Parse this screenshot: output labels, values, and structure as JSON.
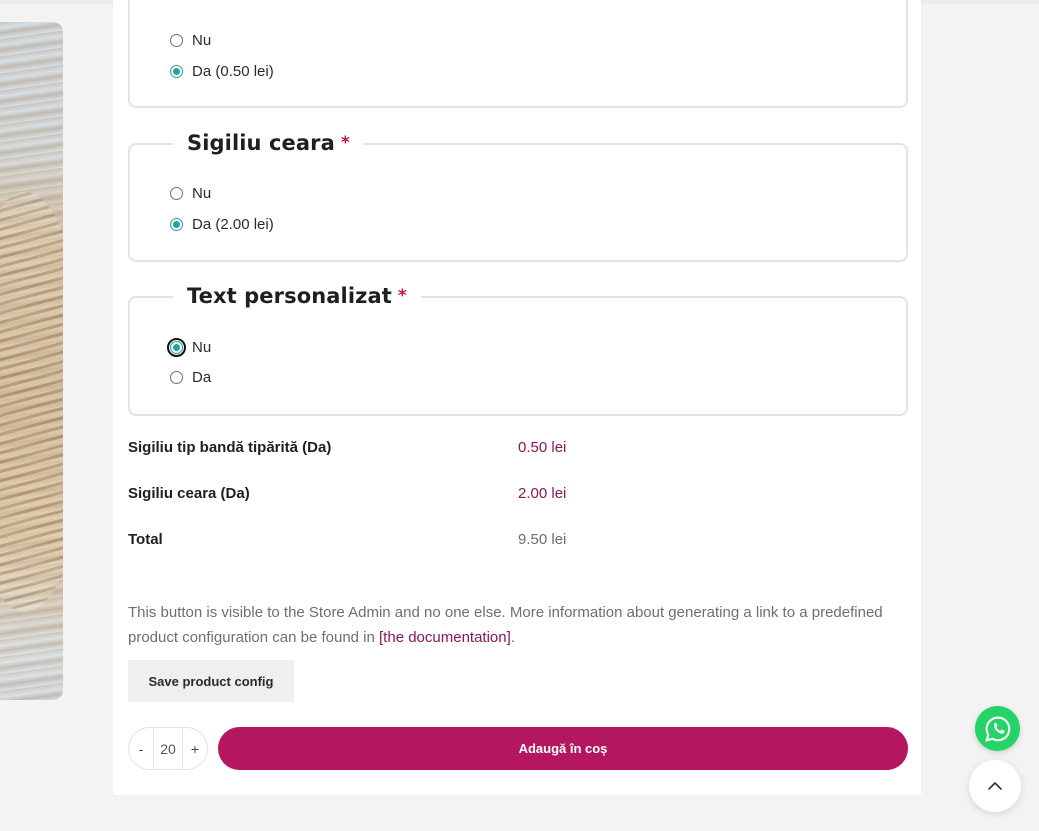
{
  "groups": [
    {
      "legend": "",
      "options": [
        {
          "label": "Nu",
          "checked": false
        },
        {
          "label": "Da (0.50 lei)",
          "checked": true
        }
      ]
    },
    {
      "legend": "Sigiliu ceara",
      "required_mark": "*",
      "options": [
        {
          "label": "Nu",
          "checked": false
        },
        {
          "label": "Da (2.00 lei)",
          "checked": true
        }
      ]
    },
    {
      "legend": "Text personalizat",
      "required_mark": "*",
      "options": [
        {
          "label": "Nu",
          "checked": true,
          "focused": true
        },
        {
          "label": "Da",
          "checked": false
        }
      ]
    }
  ],
  "summary": [
    {
      "label": "Sigiliu tip bandă tipărită (Da)",
      "value": "0.50 lei"
    },
    {
      "label": "Sigiliu ceara (Da)",
      "value": "2.00 lei"
    },
    {
      "label": "Total",
      "value": "9.50 lei"
    }
  ],
  "admin_note": {
    "text": "This button is visible to the Store Admin and no one else. More information about generating a link to a predefined product configuration can be found in",
    "link_text": "[the documentation]",
    "suffix": "."
  },
  "save_button_label": "Save product config",
  "quantity": {
    "minus": "-",
    "value": "20",
    "plus": "+"
  },
  "add_to_cart_label": "Adaugă în coș",
  "colors": {
    "accent": "#b4175f",
    "price": "#8b1656",
    "radio": "#20a3a8",
    "whatsapp": "#26d366"
  },
  "icons": {
    "whatsapp": "whatsapp-icon",
    "scroll_top": "chevron-up-icon"
  }
}
